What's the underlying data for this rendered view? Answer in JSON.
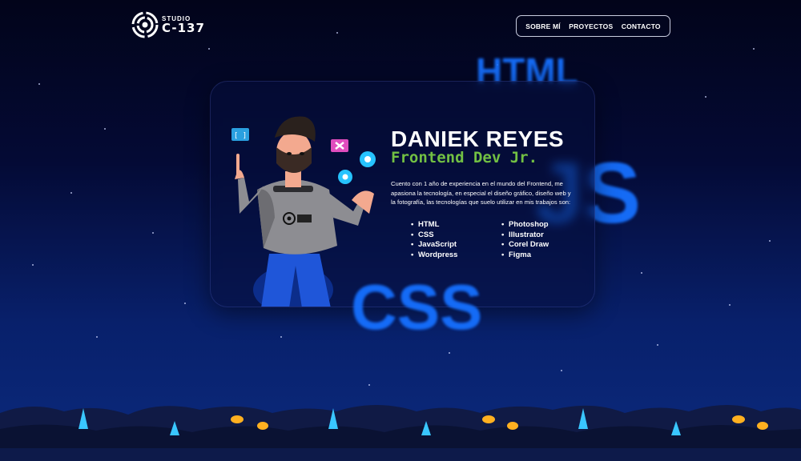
{
  "brand": {
    "small": "STUDIO",
    "big": "C-137"
  },
  "nav": {
    "items": [
      "SOBRE MÍ",
      "PROYECTOS",
      "CONTACTO"
    ]
  },
  "background_words": [
    "HTML",
    "JS",
    "CSS"
  ],
  "profile": {
    "name": "DANIEK REYES",
    "role": "Frontend Dev Jr.",
    "description": "Cuento con 1 año de experiencia en el mundo del Frontend, me apasiona la tecnología, en especial el diseño gráfico, diseño web y la fotografía, las tecnologías que suelo utilizar en mis trabajos son:",
    "skills_left": [
      "HTML",
      "CSS",
      "JavaScript",
      "Wordpress"
    ],
    "skills_right": [
      "Photoshop",
      "Illustrator",
      "Corel Draw",
      "Figma"
    ],
    "hero_badge": "[ ]"
  },
  "colors": {
    "accent_green": "#72c043",
    "accent_blue": "#1670ff",
    "bg_dark": "#02041a"
  }
}
